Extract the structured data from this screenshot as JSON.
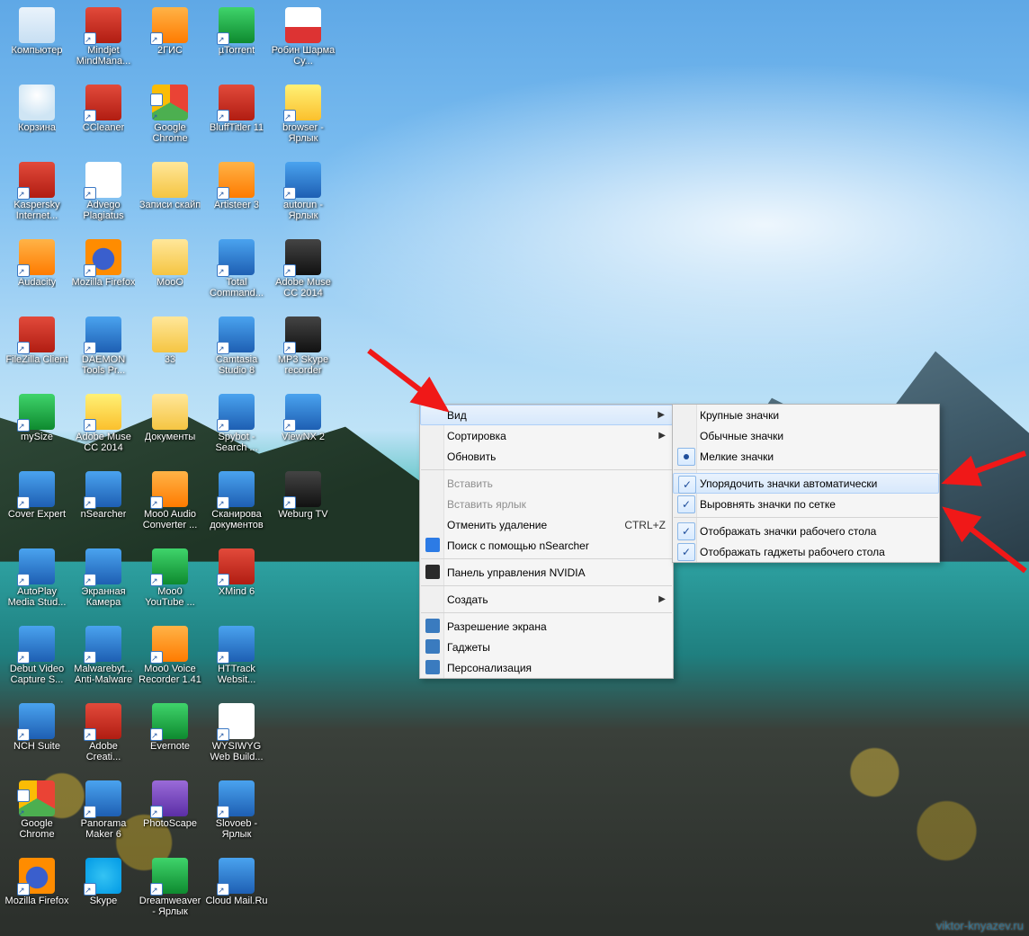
{
  "desktop_icons": [
    {
      "label": "Компьютер",
      "style": "ic-monitor",
      "shortcut": false
    },
    {
      "label": "Mindjet MindMana...",
      "style": "ic-red",
      "shortcut": true
    },
    {
      "label": "2ГИС",
      "style": "ic-orange",
      "shortcut": true
    },
    {
      "label": "µTorrent",
      "style": "ic-green",
      "shortcut": true
    },
    {
      "label": "Робин Шарма Су...",
      "style": "ic-pdf",
      "shortcut": false
    },
    {
      "label": "Корзина",
      "style": "ic-bin",
      "shortcut": false
    },
    {
      "label": "CCleaner",
      "style": "ic-red",
      "shortcut": true
    },
    {
      "label": "Google Chrome",
      "style": "ic-chrome",
      "shortcut": true
    },
    {
      "label": "BluffTitler 11",
      "style": "ic-red",
      "shortcut": true
    },
    {
      "label": "browser - Ярлык",
      "style": "ic-yellow",
      "shortcut": true
    },
    {
      "label": "Kaspersky Internet...",
      "style": "ic-red",
      "shortcut": true
    },
    {
      "label": "Advego Plagiatus",
      "style": "ic-white",
      "shortcut": true
    },
    {
      "label": "Записи скайп",
      "style": "ic-folder",
      "shortcut": false
    },
    {
      "label": "Artisteer 3",
      "style": "ic-orange",
      "shortcut": true
    },
    {
      "label": "autorun - Ярлык",
      "style": "ic-blue",
      "shortcut": true
    },
    {
      "label": "Audacity",
      "style": "ic-orange",
      "shortcut": true
    },
    {
      "label": "Mozilla Firefox",
      "style": "ic-ff",
      "shortcut": true
    },
    {
      "label": "MooO",
      "style": "ic-folder",
      "shortcut": false
    },
    {
      "label": "Total Command...",
      "style": "ic-blue",
      "shortcut": true
    },
    {
      "label": "Adobe Muse CC 2014",
      "style": "ic-dark",
      "shortcut": true
    },
    {
      "label": "FileZilla Client",
      "style": "ic-red",
      "shortcut": true
    },
    {
      "label": "DAEMON Tools Pr...",
      "style": "ic-blue",
      "shortcut": true
    },
    {
      "label": "33",
      "style": "ic-folder",
      "shortcut": false
    },
    {
      "label": "Camtasia Studio 8",
      "style": "ic-blue",
      "shortcut": true
    },
    {
      "label": "MP3 Skype recorder",
      "style": "ic-dark",
      "shortcut": true
    },
    {
      "label": "mySize",
      "style": "ic-green",
      "shortcut": true
    },
    {
      "label": "Adobe Muse CC 2014",
      "style": "ic-yellow",
      "shortcut": true
    },
    {
      "label": "Документы",
      "style": "ic-folder",
      "shortcut": false
    },
    {
      "label": "Spybot - Search ...",
      "style": "ic-blue",
      "shortcut": true
    },
    {
      "label": "ViewNX 2",
      "style": "ic-blue",
      "shortcut": true
    },
    {
      "label": "Cover Expert",
      "style": "ic-blue",
      "shortcut": true
    },
    {
      "label": "nSearcher",
      "style": "ic-blue",
      "shortcut": true
    },
    {
      "label": "Moo0 Audio Converter ...",
      "style": "ic-orange",
      "shortcut": true
    },
    {
      "label": "Сканирова документов",
      "style": "ic-blue",
      "shortcut": true
    },
    {
      "label": "Weburg TV",
      "style": "ic-dark",
      "shortcut": true
    },
    {
      "label": "AutoPlay Media Stud...",
      "style": "ic-blue",
      "shortcut": true
    },
    {
      "label": "Экранная Камера",
      "style": "ic-blue",
      "shortcut": true
    },
    {
      "label": "Moo0 YouTube ...",
      "style": "ic-green",
      "shortcut": true
    },
    {
      "label": "XMind 6",
      "style": "ic-red",
      "shortcut": true
    },
    {
      "label": "",
      "style": "",
      "shortcut": false,
      "empty": true
    },
    {
      "label": "Debut Video Capture S...",
      "style": "ic-blue",
      "shortcut": true
    },
    {
      "label": "Malwarebyt... Anti-Malware",
      "style": "ic-blue",
      "shortcut": true
    },
    {
      "label": "Moo0 Voice Recorder 1.41",
      "style": "ic-orange",
      "shortcut": true
    },
    {
      "label": "HTTrack Websit...",
      "style": "ic-blue",
      "shortcut": true
    },
    {
      "label": "",
      "style": "",
      "shortcut": false,
      "empty": true
    },
    {
      "label": "NCH Suite",
      "style": "ic-blue",
      "shortcut": true
    },
    {
      "label": "Adobe Creati...",
      "style": "ic-red",
      "shortcut": true
    },
    {
      "label": "Evernote",
      "style": "ic-green",
      "shortcut": true
    },
    {
      "label": "WYSIWYG Web Build...",
      "style": "ic-white",
      "shortcut": true
    },
    {
      "label": "",
      "style": "",
      "shortcut": false,
      "empty": true
    },
    {
      "label": "Google Chrome",
      "style": "ic-chrome",
      "shortcut": true
    },
    {
      "label": "Panorama Maker 6",
      "style": "ic-blue",
      "shortcut": true
    },
    {
      "label": "PhotoScape",
      "style": "ic-purple",
      "shortcut": true
    },
    {
      "label": "Slovoeb - Ярлык",
      "style": "ic-blue",
      "shortcut": true
    },
    {
      "label": "",
      "style": "",
      "shortcut": false,
      "empty": true
    },
    {
      "label": "Mozilla Firefox",
      "style": "ic-ff",
      "shortcut": true
    },
    {
      "label": "Skype",
      "style": "ic-skype",
      "shortcut": true
    },
    {
      "label": "Dreamweaver - Ярлык",
      "style": "ic-green",
      "shortcut": true
    },
    {
      "label": "Cloud Mail.Ru",
      "style": "ic-blue",
      "shortcut": true
    },
    {
      "label": "",
      "style": "",
      "shortcut": false,
      "empty": true
    }
  ],
  "menu1": {
    "items": [
      {
        "kind": "item",
        "label": "Вид",
        "arrow": true,
        "hover": true
      },
      {
        "kind": "item",
        "label": "Сортировка",
        "arrow": true
      },
      {
        "kind": "item",
        "label": "Обновить"
      },
      {
        "kind": "sep"
      },
      {
        "kind": "item",
        "label": "Вставить",
        "disabled": true
      },
      {
        "kind": "item",
        "label": "Вставить ярлык",
        "disabled": true
      },
      {
        "kind": "item",
        "label": "Отменить удаление",
        "shortcut": "CTRL+Z"
      },
      {
        "kind": "item",
        "label": "Поиск с помощью nSearcher",
        "icon": "search",
        "iconColor": "#2c7be5"
      },
      {
        "kind": "sep"
      },
      {
        "kind": "item",
        "label": "Панель управления NVIDIA",
        "icon": "nvidia",
        "iconColor": "#2a2a2a"
      },
      {
        "kind": "sep"
      },
      {
        "kind": "item",
        "label": "Создать",
        "arrow": true
      },
      {
        "kind": "sep"
      },
      {
        "kind": "item",
        "label": "Разрешение экрана",
        "icon": "display",
        "iconColor": "#3a7bbf"
      },
      {
        "kind": "item",
        "label": "Гаджеты",
        "icon": "gadget",
        "iconColor": "#3a7bbf"
      },
      {
        "kind": "item",
        "label": "Персонализация",
        "icon": "personalize",
        "iconColor": "#3a7bbf"
      }
    ]
  },
  "menu2": {
    "items": [
      {
        "kind": "item",
        "label": "Крупные значки"
      },
      {
        "kind": "item",
        "label": "Обычные значки"
      },
      {
        "kind": "item",
        "label": "Мелкие значки",
        "radio": true
      },
      {
        "kind": "sep"
      },
      {
        "kind": "item",
        "label": "Упорядочить значки автоматически",
        "check": true,
        "hover": true
      },
      {
        "kind": "item",
        "label": "Выровнять значки по сетке",
        "check": true
      },
      {
        "kind": "sep"
      },
      {
        "kind": "item",
        "label": "Отображать значки рабочего стола",
        "check": true
      },
      {
        "kind": "item",
        "label": "Отображать гаджеты рабочего стола",
        "check": true
      }
    ]
  },
  "watermark": "viktor-knyazev.ru"
}
